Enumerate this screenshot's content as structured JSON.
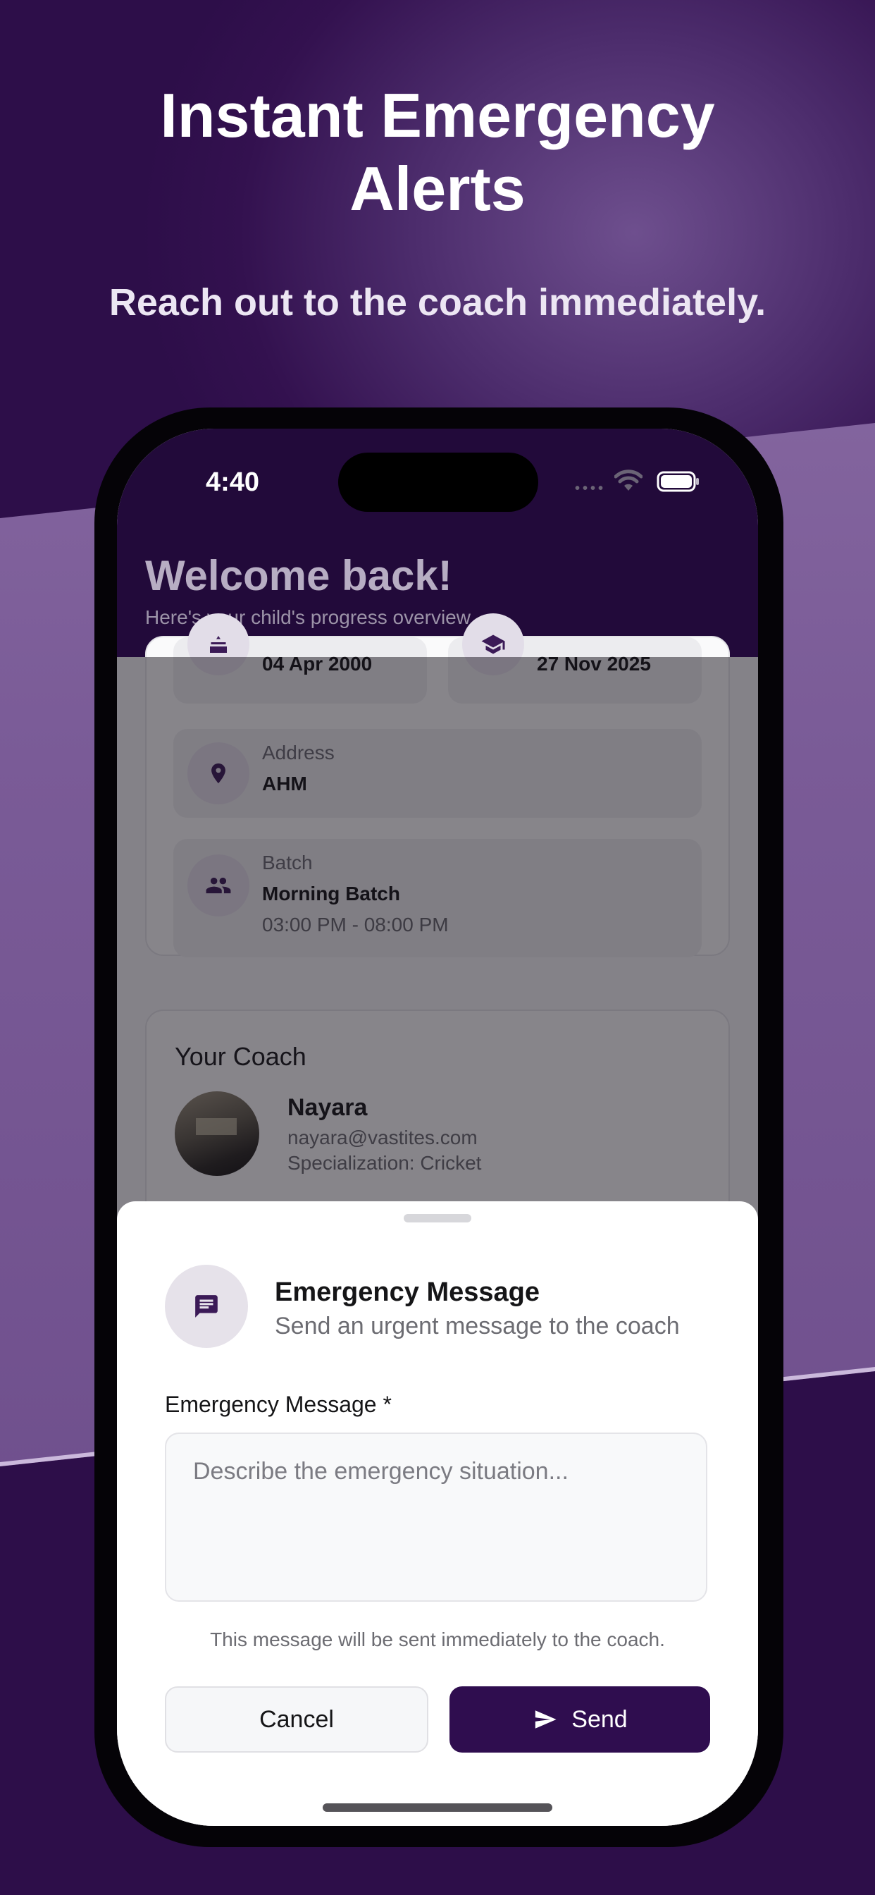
{
  "promo": {
    "headline_line1": "Instant Emergency",
    "headline_line2": "Alerts",
    "subheadline": "Reach out to the coach immediately."
  },
  "status_bar": {
    "time": "4:40",
    "signal_icon": "signal-dots-icon",
    "wifi_icon": "wifi-icon",
    "battery_icon": "battery-icon"
  },
  "header": {
    "title": "Welcome back!",
    "subtitle": "Here's your child's progress overview"
  },
  "profile": {
    "dob_value": "04 Apr 2000",
    "joined_value": "27 Nov 2025",
    "address_label": "Address",
    "address_value": "AHM",
    "batch_label": "Batch",
    "batch_value": "Morning Batch",
    "batch_time": "03:00 PM - 08:00 PM"
  },
  "coach": {
    "section_title": "Your Coach",
    "name": "Nayara",
    "email": "nayara@vastites.com",
    "specialization": "Specialization: Cricket"
  },
  "sheet": {
    "title": "Emergency Message",
    "subtitle": "Send an urgent message to the coach",
    "field_label": "Emergency Message *",
    "placeholder": "Describe the emergency situation...",
    "value": "",
    "hint": "This message will be sent immediately to the coach.",
    "cancel_label": "Cancel",
    "send_label": "Send"
  },
  "colors": {
    "brand_dark": "#220a3a",
    "send_button": "#2f0d4f",
    "icon_tint": "#3b1a57"
  }
}
